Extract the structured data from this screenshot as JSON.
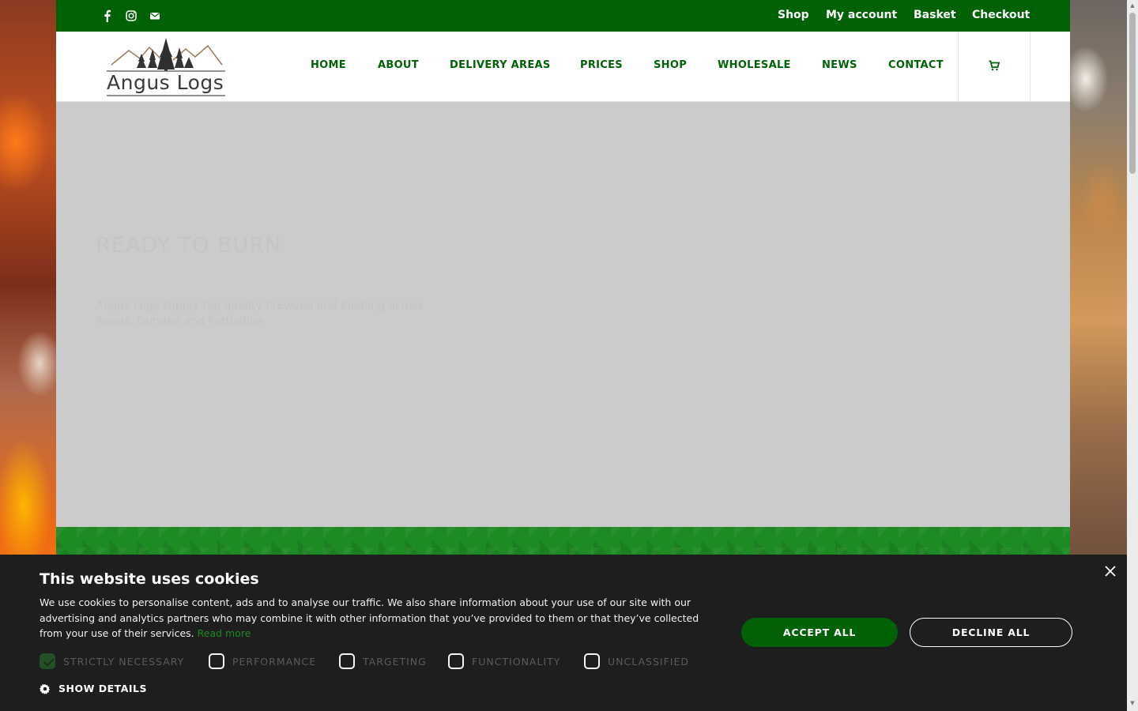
{
  "topbar": {
    "social_icons": [
      "facebook-icon",
      "instagram-icon",
      "mail-icon"
    ],
    "links": [
      "Shop",
      "My account",
      "Basket",
      "Checkout"
    ]
  },
  "header": {
    "logo_text": "Angus Logs",
    "nav": [
      "HOME",
      "ABOUT",
      "DELIVERY AREAS",
      "PRICES",
      "SHOP",
      "WHOLESALE",
      "NEWS",
      "CONTACT"
    ],
    "cart_icon": "cart-icon"
  },
  "hero": {
    "title": "READY TO BURN",
    "text": "Angus Logs supply top quality firewood and kindling across Angus, Dundee and Perthshire"
  },
  "cookie": {
    "title": "This website uses cookies",
    "text": "We use cookies to personalise content, ads and to analyse our traffic. We also share information about your use of our site with our advertising and analytics partners who may combine it with other information that you’ve provided to them or that they’ve collected from your use of their services.",
    "read_more": "Read more",
    "accept": "ACCEPT ALL",
    "decline": "DECLINE ALL",
    "categories": [
      {
        "label": "STRICTLY NECESSARY",
        "checked": true
      },
      {
        "label": "PERFORMANCE",
        "checked": false
      },
      {
        "label": "TARGETING",
        "checked": false
      },
      {
        "label": "FUNCTIONALITY",
        "checked": false
      },
      {
        "label": "UNCLASSIFIED",
        "checked": false
      }
    ],
    "show_details": "SHOW DETAILS"
  },
  "colors": {
    "brand_green": "#006106",
    "hero_bg": "#cbcbcb",
    "cookie_bg": "#1e1e1e"
  }
}
